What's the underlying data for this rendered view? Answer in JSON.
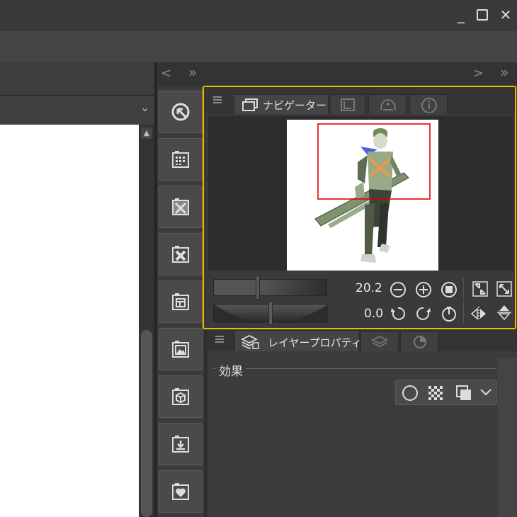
{
  "window": {
    "controls": {
      "minimize": "_",
      "maximize": "☐",
      "close": "✕"
    }
  },
  "panels": {
    "arrows": {
      "left": "<",
      "left_double": "»",
      "right": ">",
      "right_double": "»"
    },
    "left_combo_chevron": "⌄"
  },
  "navigator": {
    "tab_label": "ナビゲーター",
    "zoom_value": "20.2",
    "rotate_value": "0.0"
  },
  "layer_property": {
    "tab_label": "レイヤープロパティ",
    "section_label": "効果"
  },
  "colors": {
    "highlight_border": "#f5b800",
    "view_frame": "#e00000",
    "panel_bg": "#3a3a3a"
  },
  "icons": [
    "minimize-icon",
    "maximize-icon",
    "close-icon",
    "select-icon",
    "grid-icon",
    "material-icon",
    "delete-icon",
    "layout-icon",
    "image-icon",
    "3d-icon",
    "download-icon",
    "favorite-icon",
    "zoom-out-icon",
    "zoom-in-icon",
    "fit-icon",
    "flip-horizontal-icon",
    "flip-vertical-icon",
    "rotate-left-icon",
    "rotate-right-icon",
    "reset-rotation-icon"
  ]
}
